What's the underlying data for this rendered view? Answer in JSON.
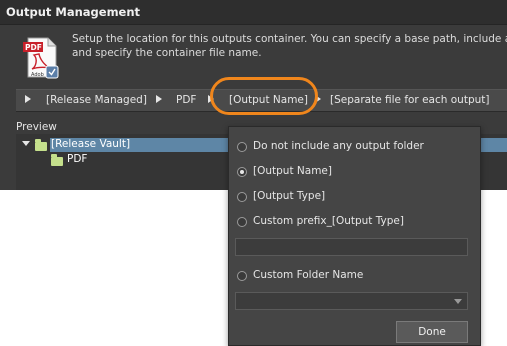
{
  "window": {
    "title": "Output Management"
  },
  "description": {
    "line1": "Setup the location for this outputs container. You can specify a base path, include a f",
    "line2": "and specify the container file name."
  },
  "icon": {
    "name": "pdf-file-icon",
    "badge_text": "PDF",
    "brand_text": "Adob"
  },
  "breadcrumb": {
    "items": [
      "[Release Managed]",
      "PDF",
      "[Output Name]",
      "[Separate file for each output]"
    ],
    "highlighted_index": 2
  },
  "preview": {
    "label": "Preview",
    "tree": [
      {
        "label": "[Release Vault]",
        "selected": true,
        "expanded": true
      },
      {
        "label": "PDF",
        "selected": false
      }
    ]
  },
  "dropdown": {
    "options": [
      {
        "label": "Do not include any output folder",
        "selected": false
      },
      {
        "label": "[Output Name]",
        "selected": true
      },
      {
        "label": "[Output Type]",
        "selected": false
      },
      {
        "label": "Custom prefix_[Output Type]",
        "selected": false
      },
      {
        "label": "Custom Folder Name",
        "selected": false
      }
    ],
    "prefix_field_value": "",
    "folder_field_value": "",
    "done_label": "Done"
  },
  "colors": {
    "highlight_ring": "#f0861c",
    "selection": "#5e86a6",
    "folder": "#c5e08c"
  }
}
